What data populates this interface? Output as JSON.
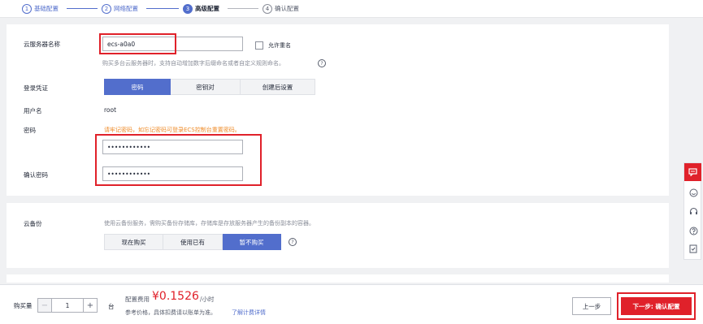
{
  "steps": [
    {
      "num": "1",
      "label": "基础配置"
    },
    {
      "num": "2",
      "label": "网络配置"
    },
    {
      "num": "3",
      "label": "高级配置"
    },
    {
      "num": "4",
      "label": "确认配置"
    }
  ],
  "server_name": {
    "label": "云服务器名称",
    "value": "ecs-a0a0",
    "allow_duplicate_label": "允许重名",
    "hint": "购买多台云服务器时，支持自动增加数字后缀命名或者自定义规则命名。"
  },
  "login": {
    "label": "登录凭证",
    "options": [
      "密码",
      "密钥对",
      "创建后设置"
    ],
    "selected": "密码"
  },
  "username": {
    "label": "用户名",
    "value": "root"
  },
  "password": {
    "label": "密码",
    "warning": "请牢记密码，如忘记密码可登录ECS控制台重置密码。",
    "value": "••••••••••••",
    "confirm_label": "确认密码",
    "confirm_value": "••••••••••••"
  },
  "backup": {
    "label": "云备份",
    "hint": "使用云备份服务，需购买备份存储库，存储库是存放服务器产生的备份副本的容器。",
    "options": [
      "现在购买",
      "使用已有",
      "暂不购买"
    ],
    "selected": "暂不购买"
  },
  "help_glyph": "?",
  "sidebar_icons": [
    "feedback-icon",
    "smile-icon",
    "headset-icon",
    "help-icon",
    "note-icon"
  ],
  "footer": {
    "quantity_label": "购买量",
    "quantity": "1",
    "unit": "台",
    "fee_label": "配置费用",
    "price": "¥0.1526",
    "price_unit": "/小时",
    "note": "参考价格，具体扣费请以账单为准。",
    "pricing_link": "了解计费详情",
    "prev_label": "上一步",
    "next_label": "下一步: 确认配置"
  },
  "colors": {
    "accent": "#526ecc",
    "danger": "#e0212a",
    "warning": "#ef8b28"
  }
}
